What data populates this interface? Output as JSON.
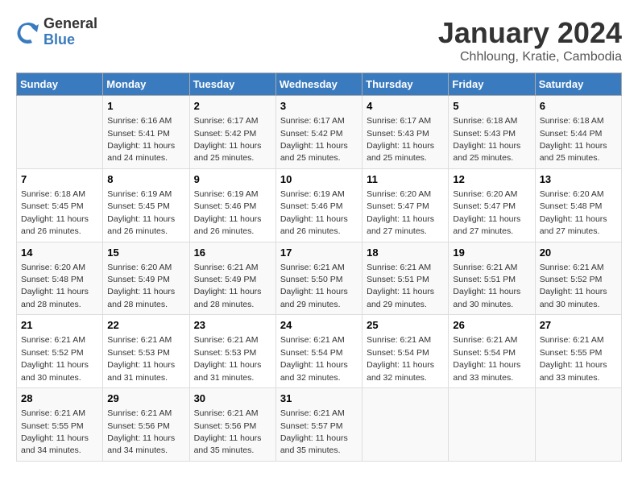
{
  "logo": {
    "text1": "General",
    "text2": "Blue"
  },
  "title": "January 2024",
  "subtitle": "Chhloung, Kratie, Cambodia",
  "days_of_week": [
    "Sunday",
    "Monday",
    "Tuesday",
    "Wednesday",
    "Thursday",
    "Friday",
    "Saturday"
  ],
  "weeks": [
    [
      {
        "num": "",
        "sunrise": "",
        "sunset": "",
        "daylight": ""
      },
      {
        "num": "1",
        "sunrise": "Sunrise: 6:16 AM",
        "sunset": "Sunset: 5:41 PM",
        "daylight": "Daylight: 11 hours and 24 minutes."
      },
      {
        "num": "2",
        "sunrise": "Sunrise: 6:17 AM",
        "sunset": "Sunset: 5:42 PM",
        "daylight": "Daylight: 11 hours and 25 minutes."
      },
      {
        "num": "3",
        "sunrise": "Sunrise: 6:17 AM",
        "sunset": "Sunset: 5:42 PM",
        "daylight": "Daylight: 11 hours and 25 minutes."
      },
      {
        "num": "4",
        "sunrise": "Sunrise: 6:17 AM",
        "sunset": "Sunset: 5:43 PM",
        "daylight": "Daylight: 11 hours and 25 minutes."
      },
      {
        "num": "5",
        "sunrise": "Sunrise: 6:18 AM",
        "sunset": "Sunset: 5:43 PM",
        "daylight": "Daylight: 11 hours and 25 minutes."
      },
      {
        "num": "6",
        "sunrise": "Sunrise: 6:18 AM",
        "sunset": "Sunset: 5:44 PM",
        "daylight": "Daylight: 11 hours and 25 minutes."
      }
    ],
    [
      {
        "num": "7",
        "sunrise": "Sunrise: 6:18 AM",
        "sunset": "Sunset: 5:45 PM",
        "daylight": "Daylight: 11 hours and 26 minutes."
      },
      {
        "num": "8",
        "sunrise": "Sunrise: 6:19 AM",
        "sunset": "Sunset: 5:45 PM",
        "daylight": "Daylight: 11 hours and 26 minutes."
      },
      {
        "num": "9",
        "sunrise": "Sunrise: 6:19 AM",
        "sunset": "Sunset: 5:46 PM",
        "daylight": "Daylight: 11 hours and 26 minutes."
      },
      {
        "num": "10",
        "sunrise": "Sunrise: 6:19 AM",
        "sunset": "Sunset: 5:46 PM",
        "daylight": "Daylight: 11 hours and 26 minutes."
      },
      {
        "num": "11",
        "sunrise": "Sunrise: 6:20 AM",
        "sunset": "Sunset: 5:47 PM",
        "daylight": "Daylight: 11 hours and 27 minutes."
      },
      {
        "num": "12",
        "sunrise": "Sunrise: 6:20 AM",
        "sunset": "Sunset: 5:47 PM",
        "daylight": "Daylight: 11 hours and 27 minutes."
      },
      {
        "num": "13",
        "sunrise": "Sunrise: 6:20 AM",
        "sunset": "Sunset: 5:48 PM",
        "daylight": "Daylight: 11 hours and 27 minutes."
      }
    ],
    [
      {
        "num": "14",
        "sunrise": "Sunrise: 6:20 AM",
        "sunset": "Sunset: 5:48 PM",
        "daylight": "Daylight: 11 hours and 28 minutes."
      },
      {
        "num": "15",
        "sunrise": "Sunrise: 6:20 AM",
        "sunset": "Sunset: 5:49 PM",
        "daylight": "Daylight: 11 hours and 28 minutes."
      },
      {
        "num": "16",
        "sunrise": "Sunrise: 6:21 AM",
        "sunset": "Sunset: 5:49 PM",
        "daylight": "Daylight: 11 hours and 28 minutes."
      },
      {
        "num": "17",
        "sunrise": "Sunrise: 6:21 AM",
        "sunset": "Sunset: 5:50 PM",
        "daylight": "Daylight: 11 hours and 29 minutes."
      },
      {
        "num": "18",
        "sunrise": "Sunrise: 6:21 AM",
        "sunset": "Sunset: 5:51 PM",
        "daylight": "Daylight: 11 hours and 29 minutes."
      },
      {
        "num": "19",
        "sunrise": "Sunrise: 6:21 AM",
        "sunset": "Sunset: 5:51 PM",
        "daylight": "Daylight: 11 hours and 30 minutes."
      },
      {
        "num": "20",
        "sunrise": "Sunrise: 6:21 AM",
        "sunset": "Sunset: 5:52 PM",
        "daylight": "Daylight: 11 hours and 30 minutes."
      }
    ],
    [
      {
        "num": "21",
        "sunrise": "Sunrise: 6:21 AM",
        "sunset": "Sunset: 5:52 PM",
        "daylight": "Daylight: 11 hours and 30 minutes."
      },
      {
        "num": "22",
        "sunrise": "Sunrise: 6:21 AM",
        "sunset": "Sunset: 5:53 PM",
        "daylight": "Daylight: 11 hours and 31 minutes."
      },
      {
        "num": "23",
        "sunrise": "Sunrise: 6:21 AM",
        "sunset": "Sunset: 5:53 PM",
        "daylight": "Daylight: 11 hours and 31 minutes."
      },
      {
        "num": "24",
        "sunrise": "Sunrise: 6:21 AM",
        "sunset": "Sunset: 5:54 PM",
        "daylight": "Daylight: 11 hours and 32 minutes."
      },
      {
        "num": "25",
        "sunrise": "Sunrise: 6:21 AM",
        "sunset": "Sunset: 5:54 PM",
        "daylight": "Daylight: 11 hours and 32 minutes."
      },
      {
        "num": "26",
        "sunrise": "Sunrise: 6:21 AM",
        "sunset": "Sunset: 5:54 PM",
        "daylight": "Daylight: 11 hours and 33 minutes."
      },
      {
        "num": "27",
        "sunrise": "Sunrise: 6:21 AM",
        "sunset": "Sunset: 5:55 PM",
        "daylight": "Daylight: 11 hours and 33 minutes."
      }
    ],
    [
      {
        "num": "28",
        "sunrise": "Sunrise: 6:21 AM",
        "sunset": "Sunset: 5:55 PM",
        "daylight": "Daylight: 11 hours and 34 minutes."
      },
      {
        "num": "29",
        "sunrise": "Sunrise: 6:21 AM",
        "sunset": "Sunset: 5:56 PM",
        "daylight": "Daylight: 11 hours and 34 minutes."
      },
      {
        "num": "30",
        "sunrise": "Sunrise: 6:21 AM",
        "sunset": "Sunset: 5:56 PM",
        "daylight": "Daylight: 11 hours and 35 minutes."
      },
      {
        "num": "31",
        "sunrise": "Sunrise: 6:21 AM",
        "sunset": "Sunset: 5:57 PM",
        "daylight": "Daylight: 11 hours and 35 minutes."
      },
      {
        "num": "",
        "sunrise": "",
        "sunset": "",
        "daylight": ""
      },
      {
        "num": "",
        "sunrise": "",
        "sunset": "",
        "daylight": ""
      },
      {
        "num": "",
        "sunrise": "",
        "sunset": "",
        "daylight": ""
      }
    ]
  ]
}
